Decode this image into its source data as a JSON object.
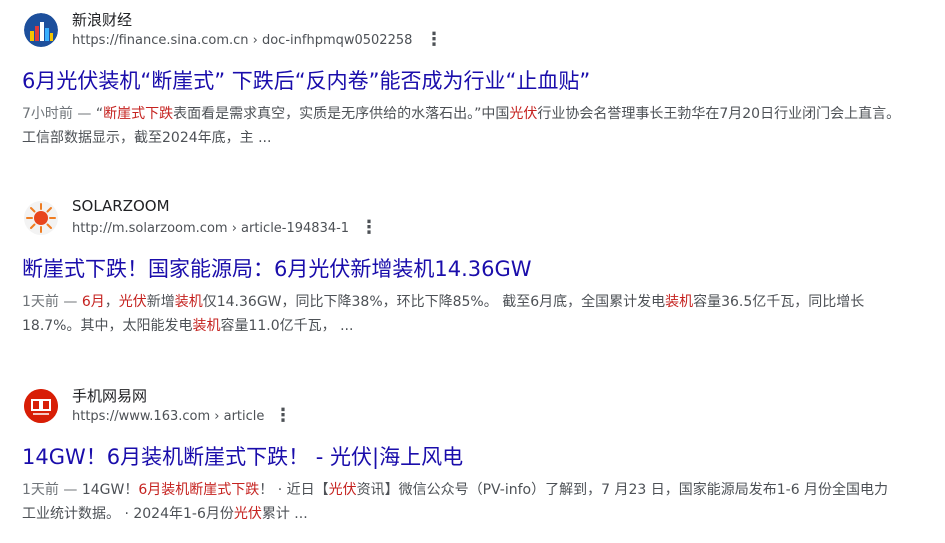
{
  "results": [
    {
      "site_name": "新浪财经",
      "url": "https://finance.sina.com.cn › doc-infhpmqw0502258",
      "favicon": "sina-finance-icon",
      "title": "6月光伏装机“断崖式” 下跌后“反内卷”能否成为行业“止血贴”",
      "date": "7小时前 — ",
      "snippet": [
        {
          "t": "“",
          "h": false
        },
        {
          "t": "断崖式下跌",
          "h": true
        },
        {
          "t": "表面看是需求真空，实质是无序供给的水落石出。”中国",
          "h": false
        },
        {
          "t": "光伏",
          "h": true
        },
        {
          "t": "行业协会名誉理事长王勃华在7月20日行业闭门会上直言。工信部数据显示，截至2024年底，主 ...",
          "h": false
        }
      ]
    },
    {
      "site_name": "SOLARZOOM",
      "url": "http://m.solarzoom.com › article-194834-1",
      "favicon": "sun-icon",
      "title": "断崖式下跌！国家能源局：6月光伏新增装机14.36GW",
      "date": "1天前 — ",
      "snippet": [
        {
          "t": "6月",
          "h": true
        },
        {
          "t": "，",
          "h": false
        },
        {
          "t": "光伏",
          "h": true
        },
        {
          "t": "新增",
          "h": false
        },
        {
          "t": "装机",
          "h": true
        },
        {
          "t": "仅14.36GW，同比下降38%，环比下降85%。 截至6月底，全国累计发电",
          "h": false
        },
        {
          "t": "装机",
          "h": true
        },
        {
          "t": "容量36.5亿千瓦，同比增长18.7%。其中，太阳能发电",
          "h": false
        },
        {
          "t": "装机",
          "h": true
        },
        {
          "t": "容量11.0亿千瓦， ...",
          "h": false
        }
      ]
    },
    {
      "site_name": "手机网易网",
      "url": "https://www.163.com › article",
      "favicon": "netease-icon",
      "title": "14GW！6月装机断崖式下跌！ - 光伏|海上风电",
      "date": "1天前 — ",
      "snippet": [
        {
          "t": "14GW！",
          "h": false
        },
        {
          "t": "6月装机断崖式下跌",
          "h": true
        },
        {
          "t": "！ · 近日【",
          "h": false
        },
        {
          "t": "光伏",
          "h": true
        },
        {
          "t": "资讯】微信公众号（PV-info）了解到，7 月23 日，国家能源局发布1-6 月份全国电力工业统计数据。 · 2024年1-6月份",
          "h": false
        },
        {
          "t": "光伏",
          "h": true
        },
        {
          "t": "累计 ...",
          "h": false
        }
      ]
    }
  ],
  "colors": {
    "title_link": "#1a0dab",
    "snippet_text": "#4d5156",
    "highlight": "#c5221f"
  }
}
